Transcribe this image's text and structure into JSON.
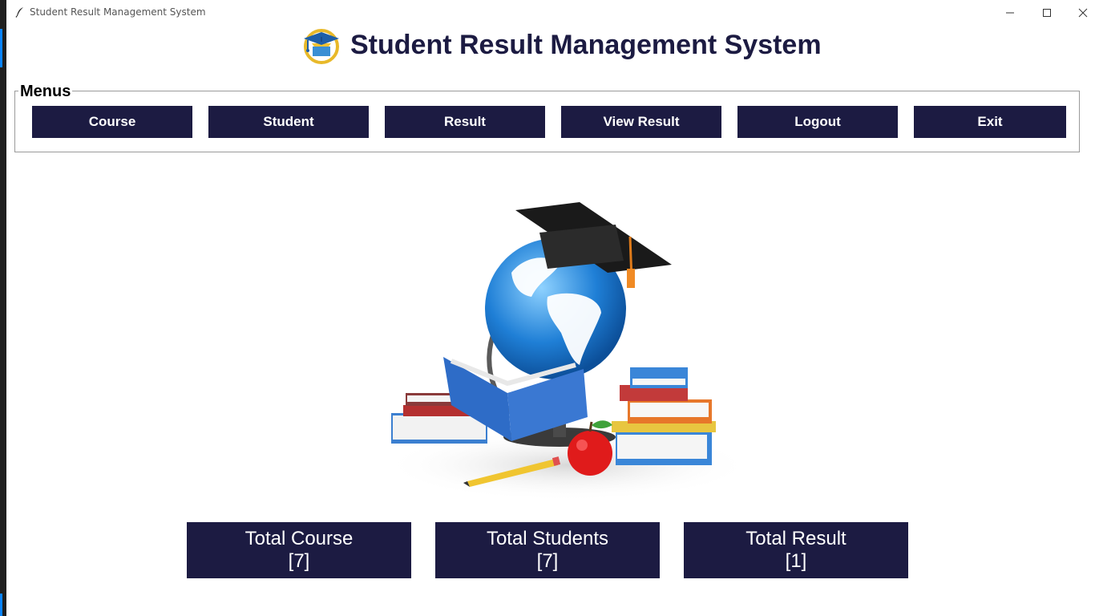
{
  "window": {
    "title": "Student Result Management System"
  },
  "header": {
    "title": "Student Result Management System",
    "logo_icon": "graduation-cap-icon"
  },
  "menus": {
    "legend": "Menus",
    "buttons": [
      {
        "label": "Course"
      },
      {
        "label": "Student"
      },
      {
        "label": "Result"
      },
      {
        "label": "View Result"
      },
      {
        "label": "Logout"
      },
      {
        "label": "Exit"
      }
    ]
  },
  "stats": [
    {
      "label": "Total Course",
      "value": "[7]"
    },
    {
      "label": "Total Students",
      "value": "[7]"
    },
    {
      "label": "Total Result",
      "value": "[1]"
    }
  ],
  "colors": {
    "primary": "#1c1b42",
    "button_text": "#ffffff",
    "accent_gold": "#e8b92a",
    "taskbar_accent": "#0a84ff"
  }
}
